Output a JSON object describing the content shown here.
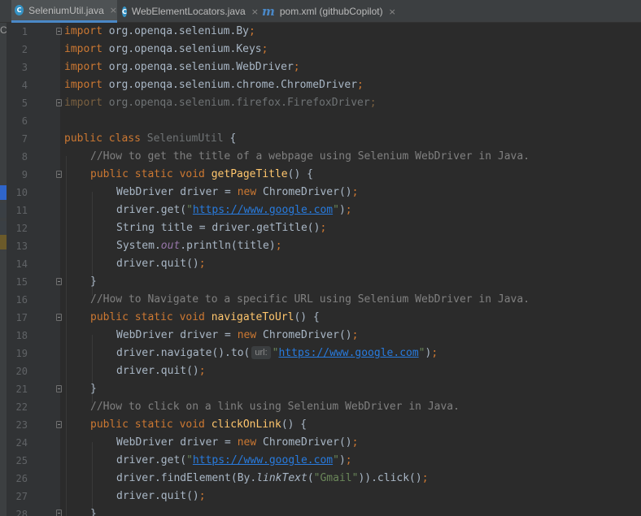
{
  "tabs": [
    {
      "label": "SeleniumUtil.java",
      "icon": "java-class-icon",
      "active": true
    },
    {
      "label": "WebElementLocators.java",
      "icon": "java-class-icon",
      "active": false
    },
    {
      "label": "pom.xml (githubCopilot)",
      "icon": "maven-icon",
      "active": false
    }
  ],
  "tab_close_glyph": "×",
  "left_strip_label": "C",
  "line_numbers": [
    "1",
    "2",
    "3",
    "4",
    "5",
    "6",
    "7",
    "8",
    "9",
    "10",
    "11",
    "12",
    "13",
    "14",
    "15",
    "16",
    "17",
    "18",
    "19",
    "20",
    "21",
    "22",
    "23",
    "24",
    "25",
    "26",
    "27",
    "28"
  ],
  "code": {
    "l1": {
      "kw": "import",
      "rest": " org.openqa.selenium.By",
      "semi": ";"
    },
    "l2": {
      "kw": "import",
      "rest": " org.openqa.selenium.Keys",
      "semi": ";"
    },
    "l3": {
      "kw": "import",
      "rest": " org.openqa.selenium.WebDriver",
      "semi": ";"
    },
    "l4": {
      "kw": "import",
      "rest": " org.openqa.selenium.chrome.ChromeDriver",
      "semi": ";"
    },
    "l5": {
      "kw": "import",
      "rest": " org.openqa.selenium.firefox.FirefoxDriver",
      "semi": ";"
    },
    "l7": {
      "kw": "public class",
      "name": "SeleniumUtil",
      "rest": " {"
    },
    "l8": {
      "comment": "//How to get the title of a webpage using Selenium WebDriver in Java."
    },
    "l9": {
      "kw": "public static void",
      "name": "getPageTitle",
      "rest": "() {"
    },
    "l10": {
      "a": "WebDriver driver = ",
      "kw": "new",
      "b": " ChromeDriver()",
      "semi": ";"
    },
    "l11": {
      "a": "driver.get(",
      "q1": "\"",
      "url": "https://www.google.com",
      "q2": "\"",
      "b": ")",
      "semi": ";"
    },
    "l12": {
      "a": "String title = driver.getTitle()",
      "semi": ";"
    },
    "l13": {
      "a": "System.",
      "field": "out",
      "b": ".println(title)",
      "semi": ";"
    },
    "l14": {
      "a": "driver.quit()",
      "semi": ";"
    },
    "l15": {
      "a": "}"
    },
    "l16": {
      "comment": "//How to Navigate to a specific URL using Selenium WebDriver in Java."
    },
    "l17": {
      "kw": "public static void",
      "name": "navigateToUrl",
      "rest": "() {"
    },
    "l18": {
      "a": "WebDriver driver = ",
      "kw": "new",
      "b": " ChromeDriver()",
      "semi": ";"
    },
    "l19": {
      "a": "driver.navigate().to(",
      "hint": "url:",
      "q1": "\"",
      "url": "https://www.google.com",
      "q2": "\"",
      "b": ")",
      "semi": ";"
    },
    "l20": {
      "a": "driver.quit()",
      "semi": ";"
    },
    "l21": {
      "a": "}"
    },
    "l22": {
      "comment": "//How to click on a link using Selenium WebDriver in Java."
    },
    "l23": {
      "kw": "public static void",
      "name": "clickOnLink",
      "rest": "() {"
    },
    "l24": {
      "a": "WebDriver driver = ",
      "kw": "new",
      "b": " ChromeDriver()",
      "semi": ";"
    },
    "l25": {
      "a": "driver.get(",
      "q1": "\"",
      "url": "https://www.google.com",
      "q2": "\"",
      "b": ")",
      "semi": ";"
    },
    "l26": {
      "a": "driver.findElement(By.",
      "method": "linkText",
      "b": "(",
      "str": "\"Gmail\"",
      "c": ")).click()",
      "semi": ";"
    },
    "l27": {
      "a": "driver.quit()",
      "semi": ";"
    },
    "l28": {
      "a": "}"
    }
  },
  "colors": {
    "editor_bg": "#2b2b2b",
    "keyword": "#cc7832",
    "method_decl": "#ffc66d",
    "string": "#6a8759",
    "url": "#287bde",
    "comment": "#808080",
    "static_field": "#9876aa",
    "identifier": "#a9b7c6",
    "active_tab_underline": "#4a88c7"
  }
}
